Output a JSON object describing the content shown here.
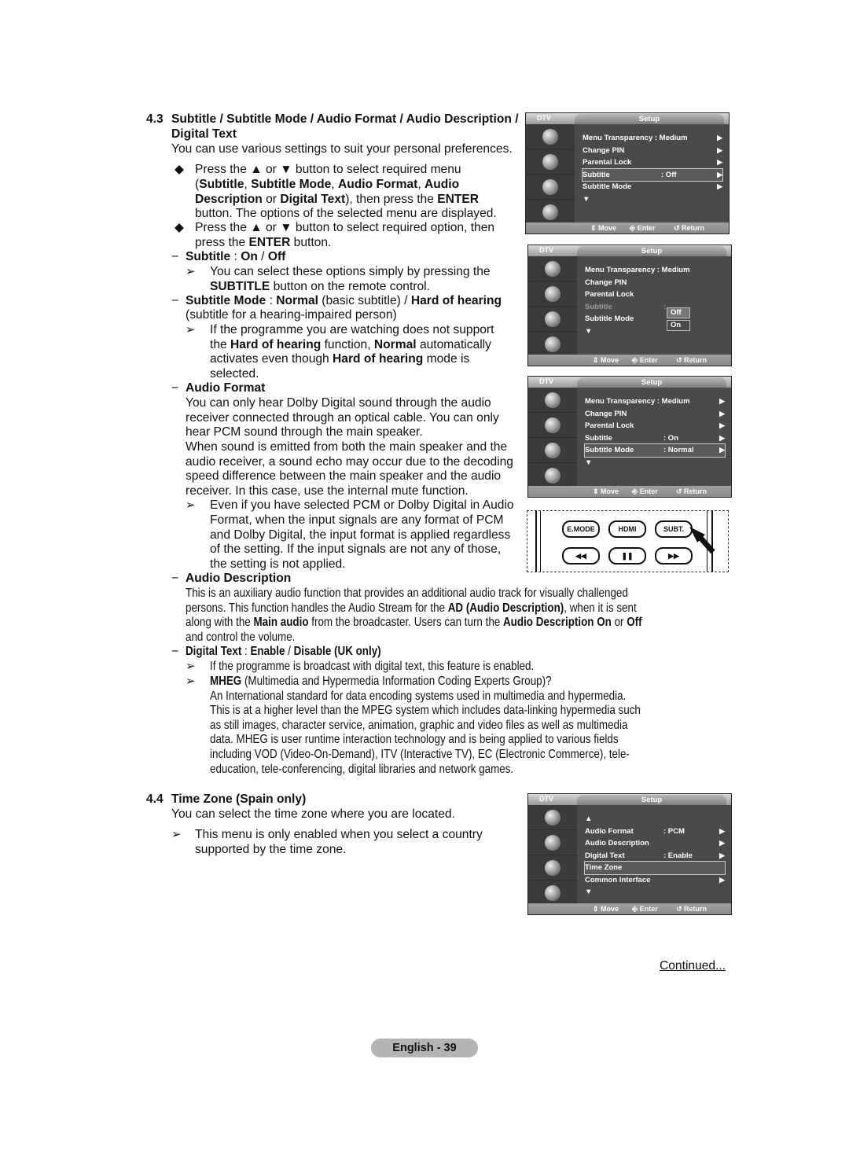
{
  "section_4_3": {
    "number": "4.3",
    "title_line1": "Subtitle / Subtitle Mode / Audio Format / Audio Description /",
    "title_line2": "Digital Text",
    "intro": "You can use various settings to suit your personal preferences.",
    "bullet1": {
      "l1": "Press the ▲ or ▼ button to select required menu",
      "l2a": "(",
      "l2b": "Subtitle",
      "l2c": ", ",
      "l2d": "Subtitle Mode",
      "l2e": ", ",
      "l2f": "Audio Format",
      "l2g": ", ",
      "l2h": "Audio",
      "l3a": "Description",
      "l3b": " or ",
      "l3c": "Digital Text",
      "l3d": "), then press the ",
      "l3e": "ENTER",
      "l4": "button. The options of the selected menu are displayed."
    },
    "bullet2": {
      "l1": "Press the ▲ or ▼ button to select required option, then",
      "l2a": "press the ",
      "l2b": "ENTER",
      "l2c": " button."
    },
    "subtitle": {
      "head_a": "Subtitle",
      "head_b": " : ",
      "head_c": "On",
      "head_d": " / ",
      "head_e": "Off",
      "note_l1": "You can select these options simply by pressing the",
      "note_l2a": "SUBTITLE",
      "note_l2b": " button on the remote control."
    },
    "subtitle_mode": {
      "head_a": "Subtitle Mode",
      "head_b": " : ",
      "head_c": "Normal",
      "head_d": " (basic subtitle) / ",
      "head_e": "Hard of hearing",
      "l2": "(subtitle for a hearing-impaired person)",
      "note_l1": "If the programme you are watching does not support",
      "note_l2a": "the ",
      "note_l2b": "Hard of hearing",
      "note_l2c": " function, ",
      "note_l2d": "Normal",
      "note_l2e": " automatically",
      "note_l3a": "activates even though ",
      "note_l3b": "Hard of hearing",
      "note_l3c": " mode is",
      "note_l4": "selected."
    },
    "audio_format": {
      "head": "Audio Format",
      "lines": [
        "You can only hear Dolby Digital sound through the audio",
        "receiver connected through an optical cable. You can only",
        "hear PCM sound through the main speaker.",
        "When sound is emitted from both the main speaker and the",
        "audio receiver, a sound echo may occur due to the decoding",
        "speed difference between the main speaker and the audio",
        "receiver. In this case, use the internal mute function."
      ],
      "note": [
        "Even if you have selected PCM or Dolby Digital in Audio",
        "Format, when the input signals are any format of PCM",
        "and Dolby Digital, the input format is applied regardless",
        "of the setting. If the input signals are not any of those,",
        "the setting is not applied."
      ]
    },
    "audio_description": {
      "head": "Audio Description",
      "l1": "This is an auxiliary audio function that provides an additional audio track for visually challenged",
      "l2a": "persons. This function handles the Audio Stream for the ",
      "l2b": "AD (Audio Description)",
      "l2c": ", when it is sent",
      "l3a": "along with the ",
      "l3b": "Main audio",
      "l3c": " from the broadcaster. Users can turn the ",
      "l3d": "Audio Description On",
      "l3e": " or ",
      "l3f": "Off",
      "l4": "and control the volume."
    },
    "digital_text": {
      "head_a": "Digital Text",
      "head_b": " : ",
      "head_c": "Enable",
      "head_d": " / ",
      "head_e": "Disable (UK only)",
      "note1": "If the programme is broadcast with digital text, this feature is enabled.",
      "note2a": "MHEG",
      "note2b": " (Multimedia and Hypermedia Information Coding Experts Group)?",
      "para": [
        "An International standard for data encoding systems used in multimedia and hypermedia.",
        "This is at a higher level than the MPEG system which includes data-linking hypermedia such",
        "as still images, character service, animation, graphic and video files as well as multimedia",
        "data. MHEG is user runtime interaction technology and is being applied to various fields",
        "including VOD (Video-On-Demand), ITV (Interactive TV), EC (Electronic Commerce), tele-",
        "education, tele-conferencing, digital libraries and network games."
      ]
    }
  },
  "section_4_4": {
    "number": "4.4",
    "title": "Time Zone (Spain only)",
    "intro": "You can select the time zone where you are located.",
    "note_l1": "This menu is only enabled when you select a country",
    "note_l2": "supported by the time zone."
  },
  "osd_common": {
    "source": "DTV",
    "title": "Setup",
    "move": "Move",
    "enter": "Enter",
    "return": "Return",
    "arrow_right": "▶",
    "arrow_down": "▼",
    "arrow_up": "▲"
  },
  "osd1": {
    "rows": [
      {
        "label": "Menu Transparency : Medium",
        "value": ""
      },
      {
        "label": "Change PIN",
        "value": ""
      },
      {
        "label": "Parental Lock",
        "value": ""
      },
      {
        "label": "Subtitle",
        "value": ": Off"
      },
      {
        "label": "Subtitle Mode",
        "value": ""
      }
    ],
    "selected": "Subtitle"
  },
  "osd2": {
    "rows": [
      {
        "label": "Menu Transparency : Medium",
        "value": ""
      },
      {
        "label": "Change PIN",
        "value": ""
      },
      {
        "label": "Parental Lock",
        "value": ""
      },
      {
        "label": "Subtitle",
        "value": ":"
      },
      {
        "label": "Subtitle Mode",
        "value": ""
      }
    ],
    "popup_options": [
      "Off",
      "On"
    ],
    "popup_highlight": "Off"
  },
  "osd3": {
    "rows": [
      {
        "label": "Menu Transparency : Medium",
        "value": ""
      },
      {
        "label": "Change PIN",
        "value": ""
      },
      {
        "label": "Parental Lock",
        "value": ""
      },
      {
        "label": "Subtitle",
        "value": ": On"
      },
      {
        "label": "Subtitle Mode",
        "value": ": Normal"
      }
    ],
    "selected": "Subtitle Mode"
  },
  "osd4": {
    "rows": [
      {
        "label": "Audio Format",
        "value": ": PCM"
      },
      {
        "label": "Audio Description",
        "value": ""
      },
      {
        "label": "Digital Text",
        "value": ": Enable"
      },
      {
        "label": "Time Zone",
        "value": ""
      },
      {
        "label": "Common Interface",
        "value": ""
      }
    ],
    "selected": "Time Zone"
  },
  "remote": {
    "buttons_top": [
      "E.MODE",
      "HDMI",
      "SUBT."
    ],
    "buttons_bottom": [
      "◀◀",
      "❚❚",
      "▶▶"
    ]
  },
  "footer": {
    "continued": "Continued...",
    "page_label": "English - 39"
  }
}
